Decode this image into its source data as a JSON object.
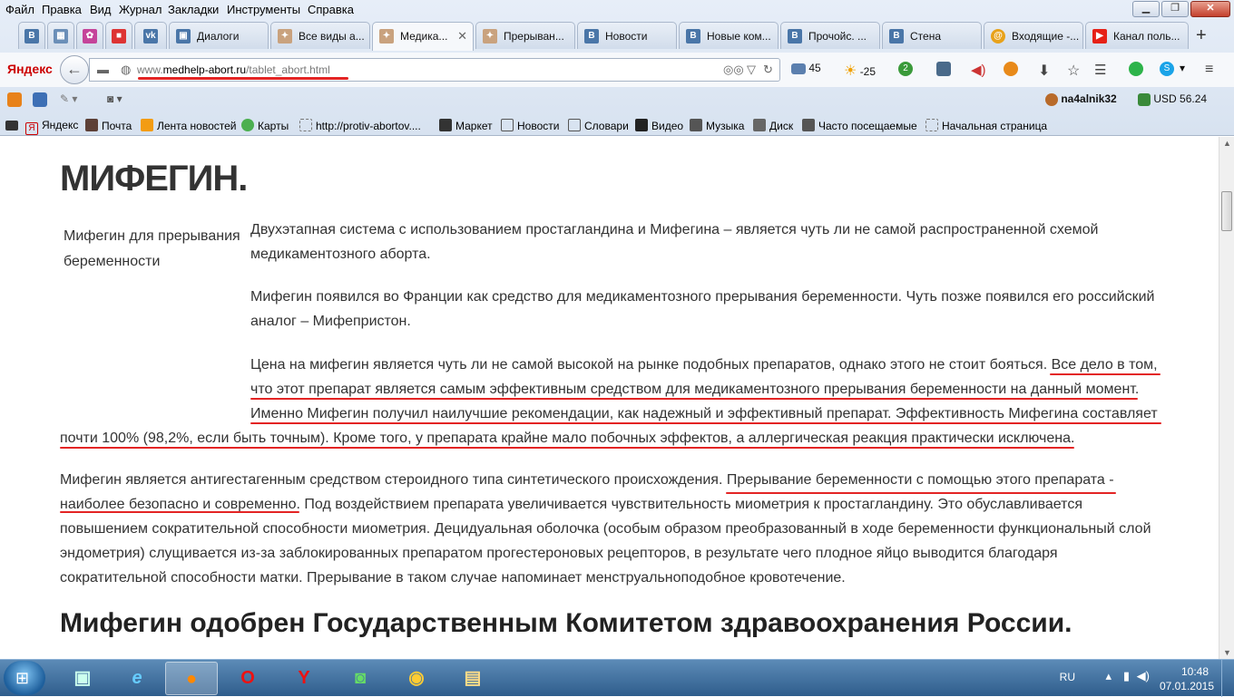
{
  "menu": [
    "Файл",
    "Правка",
    "Вид",
    "Журнал",
    "Закладки",
    "Инструменты",
    "Справка"
  ],
  "window_buttons": {
    "minimize": "▁",
    "maximize": "❐",
    "close": "✕"
  },
  "tabs": [
    {
      "label": "",
      "icon": "vk-icon"
    },
    {
      "label": "",
      "icon": "image-icon"
    },
    {
      "label": "",
      "icon": "puzzle-icon"
    },
    {
      "label": "",
      "icon": "grid-icon"
    },
    {
      "label": "",
      "icon": "vk-icon"
    },
    {
      "label": "Диалоги",
      "icon": "vk-icon"
    },
    {
      "label": "Все виды а...",
      "icon": "medhelp-icon"
    },
    {
      "label": "Медика...",
      "icon": "medhelp-icon",
      "active": true
    },
    {
      "label": "Прерыван...",
      "icon": "medhelp-icon"
    },
    {
      "label": "Новости",
      "icon": "vk-icon"
    },
    {
      "label": "Новые ком...",
      "icon": "vk-icon"
    },
    {
      "label": "Прочойс. ...",
      "icon": "vk-icon"
    },
    {
      "label": "Стена",
      "icon": "vk-icon"
    },
    {
      "label": "Входящие -...",
      "icon": "mail-icon"
    },
    {
      "label": "Канал поль...",
      "icon": "youtube-icon"
    }
  ],
  "new_tab_label": "+",
  "navbar": {
    "brand": "Яндекс",
    "url_prefix": "www.",
    "url_domain": "medhelp-abort.ru",
    "url_path": "/tablet_abort.html",
    "mail_count": "45",
    "weather": "-25",
    "badge_count": "2"
  },
  "toolbar2": {
    "user": "na4alnik32",
    "currency": "USD 56.24"
  },
  "bookmarks": [
    {
      "label": "Яндекс",
      "icon": "yandex-icon"
    },
    {
      "label": "Почта",
      "icon": "mail-icon"
    },
    {
      "label": "Лента новостей",
      "icon": "rss-icon"
    },
    {
      "label": "Карты",
      "icon": "maps-icon"
    },
    {
      "label": "http://protiv-abortov....",
      "icon": "page-icon"
    },
    {
      "label": "Маркет",
      "icon": "market-icon"
    },
    {
      "label": "Новости",
      "icon": "news-icon"
    },
    {
      "label": "Словари",
      "icon": "dictionary-icon"
    },
    {
      "label": "Видео",
      "icon": "video-icon"
    },
    {
      "label": "Музыка",
      "icon": "music-icon"
    },
    {
      "label": "Диск",
      "icon": "disk-icon"
    },
    {
      "label": "Часто посещаемые",
      "icon": "frequent-icon"
    },
    {
      "label": "Начальная страница",
      "icon": "page-icon"
    }
  ],
  "article": {
    "title": "МИФЕГИН.",
    "image_caption": "Мифегин для прерывания беременности",
    "p1": "Двухэтапная система с использованием простагландина и Мифегина – является чуть ли не самой распространенной схемой медикаментозного аборта.",
    "p2": "Мифегин появился во Франции как средство для медикаментозного прерывания беременности. Чуть позже появился его российский аналог – Мифепристон.",
    "p3_line1": "Цена на мифегин является чуть ли не самой высокой на рынке подобных препаратов, однако этого не стоит бояться. Все дело в том,",
    "p3_line2": "что этот препарат является самым эффективным средством для медикаментозного прерывания беременности на данный момент.",
    "p3_line3": "Именно Мифегин получил наилучшие рекомендации, как надежный и эффективный препарат. Эффективность Мифегина составляет",
    "p3_line4": "почти 100% (98,2%, если быть точным). Кроме того, у препарата крайне мало побочных эффектов, а аллергическая реакция практически исключена.",
    "p4_line1": "Мифегин является антигестагенным средством стероидного типа синтетического происхождения. Прерывание беременности с помощью этого препарата -",
    "p4_line2": "наиболее безопасно и современно. Под воздействием препарата увеличивается чувствительность миометрия к простагландину. Это обуславливается",
    "p4_line3": "повышением сократительной способности миометрия. Децидуальная оболочка (особым образом преобразованный в ходе беременности функциональный слой",
    "p4_line4": "эндометрия) слущивается из-за заблокированных препаратом прогестероновых рецепторов, в результате чего плодное яйцо выводится благодаря",
    "p4_line5": "сократительной способности матки. Прерывание в таком случае напоминает менструальноподобное кровотечение.",
    "subtitle": "Мифегин одобрен Государственным Комитетом здравоохранения России."
  },
  "taskbar": {
    "apps": [
      "hardware-icon",
      "ie-icon",
      "firefox-icon",
      "opera-icon",
      "yandex-browser-icon",
      "skype-icon",
      "chrome-icon",
      "explorer-icon"
    ],
    "lang": "RU",
    "time": "10:48",
    "date": "07.01.2015"
  },
  "colors": {
    "underline": "#e32424",
    "vk": "#4a76a8",
    "youtube": "#e62117"
  }
}
